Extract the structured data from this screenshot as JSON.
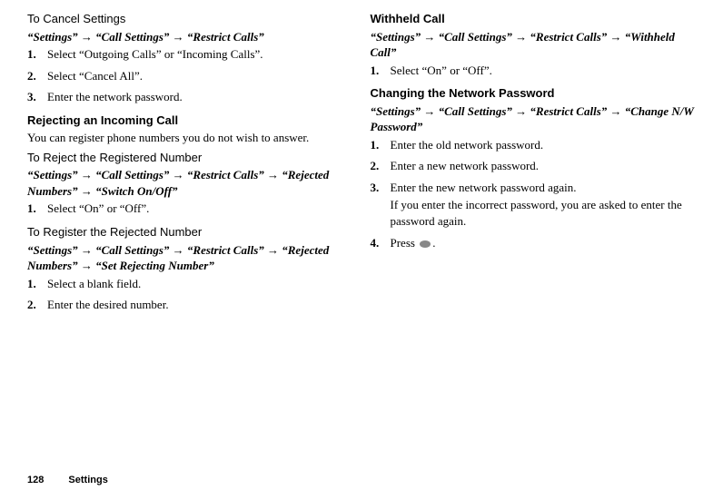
{
  "left": {
    "sec1_title": "To Cancel Settings",
    "sec1_path": "“Settings” → “Call Settings” → “Restrict Calls”",
    "sec1_step1": "Select “Outgoing Calls” or “Incoming Calls”.",
    "sec1_step2": "Select “Cancel All”.",
    "sec1_step3": "Enter the network password.",
    "sec2_title": "Rejecting an Incoming Call",
    "sec2_body": "You can register phone numbers you do not wish to answer.",
    "sec3_title": "To Reject the Registered Number",
    "sec3_path": "“Settings” → “Call Settings” → “Restrict Calls” → “Rejected Numbers” → “Switch On/Off”",
    "sec3_step1": "Select “On” or “Off”.",
    "sec4_title": "To Register the Rejected Number",
    "sec4_path": "“Settings” → “Call Settings” → “Restrict Calls” → “Rejected Numbers” → “Set Rejecting Number”",
    "sec4_step1": "Select a blank field.",
    "sec4_step2": "Enter the desired number."
  },
  "right": {
    "sec5_title": "Withheld Call",
    "sec5_path": "“Settings” → “Call Settings” → “Restrict Calls” → “Withheld Call”",
    "sec5_step1": "Select “On” or “Off”.",
    "sec6_title": "Changing the Network Password",
    "sec6_path": "“Settings” → “Call Settings” → “Restrict Calls” → “Change N/W Password”",
    "sec6_step1": "Enter the old network password.",
    "sec6_step2": "Enter a new network password.",
    "sec6_step3": "Enter the new network password again.",
    "sec6_step3_sub": "If you enter the incorrect password, you are asked to enter the password again.",
    "sec6_step4_pre": "Press ",
    "sec6_step4_post": "."
  },
  "footer": {
    "page_number": "128",
    "section_name": "Settings"
  }
}
